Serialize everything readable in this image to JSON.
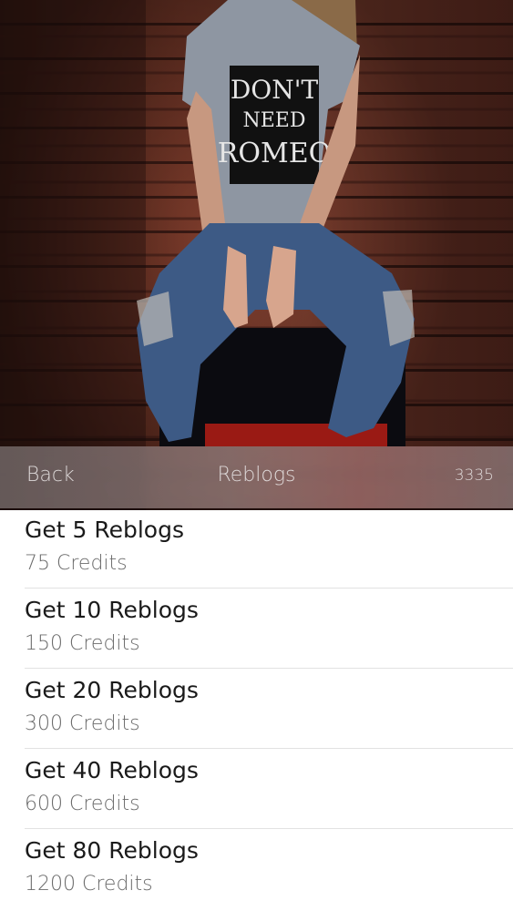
{
  "hero": {
    "shirt_text": [
      "DON'T",
      "NEED",
      "ROMEO"
    ],
    "colors": {
      "brick": "#7a3a2a",
      "shirt": "#8e96a2",
      "jeans": "#3d5a85"
    }
  },
  "navbar": {
    "back_label": "Back",
    "title": "Reblogs",
    "credits": "3335"
  },
  "packages": [
    {
      "title": "Get 5 Reblogs",
      "price": "75 Credits"
    },
    {
      "title": "Get 10 Reblogs",
      "price": "150 Credits"
    },
    {
      "title": "Get 20 Reblogs",
      "price": "300 Credits"
    },
    {
      "title": "Get 40 Reblogs",
      "price": "600 Credits"
    },
    {
      "title": "Get 80 Reblogs",
      "price": "1200 Credits"
    }
  ]
}
